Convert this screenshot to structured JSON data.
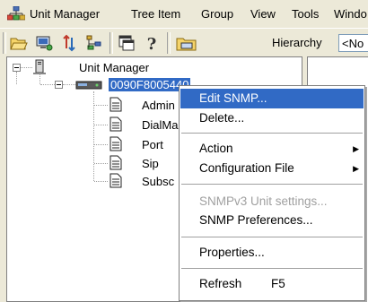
{
  "menubar": {
    "items": [
      "Unit Manager",
      "Tree Item",
      "Group",
      "View",
      "Tools",
      "Windo"
    ]
  },
  "toolbar": {
    "hierarchy_label": "Hierarchy",
    "hierarchy_value": "<No"
  },
  "tree": {
    "root_label": "Unit Manager",
    "unit_label": "0090F8005440",
    "children": [
      "Admin",
      "DialMa",
      "Port",
      "Sip",
      "Subsc"
    ]
  },
  "context_menu": {
    "items": [
      {
        "label": "Edit SNMP...",
        "highlighted": true
      },
      {
        "label": "Delete..."
      },
      {
        "label": "Action",
        "submenu": true
      },
      {
        "label": "Configuration File",
        "submenu": true
      },
      {
        "label": "SNMPv3 Unit settings...",
        "disabled": true
      },
      {
        "label": "SNMP Preferences..."
      },
      {
        "label": "Properties..."
      },
      {
        "label": "Refresh",
        "shortcut": "F5"
      }
    ]
  },
  "colors": {
    "selection": "#316ac5",
    "chrome": "#ece9d8"
  }
}
